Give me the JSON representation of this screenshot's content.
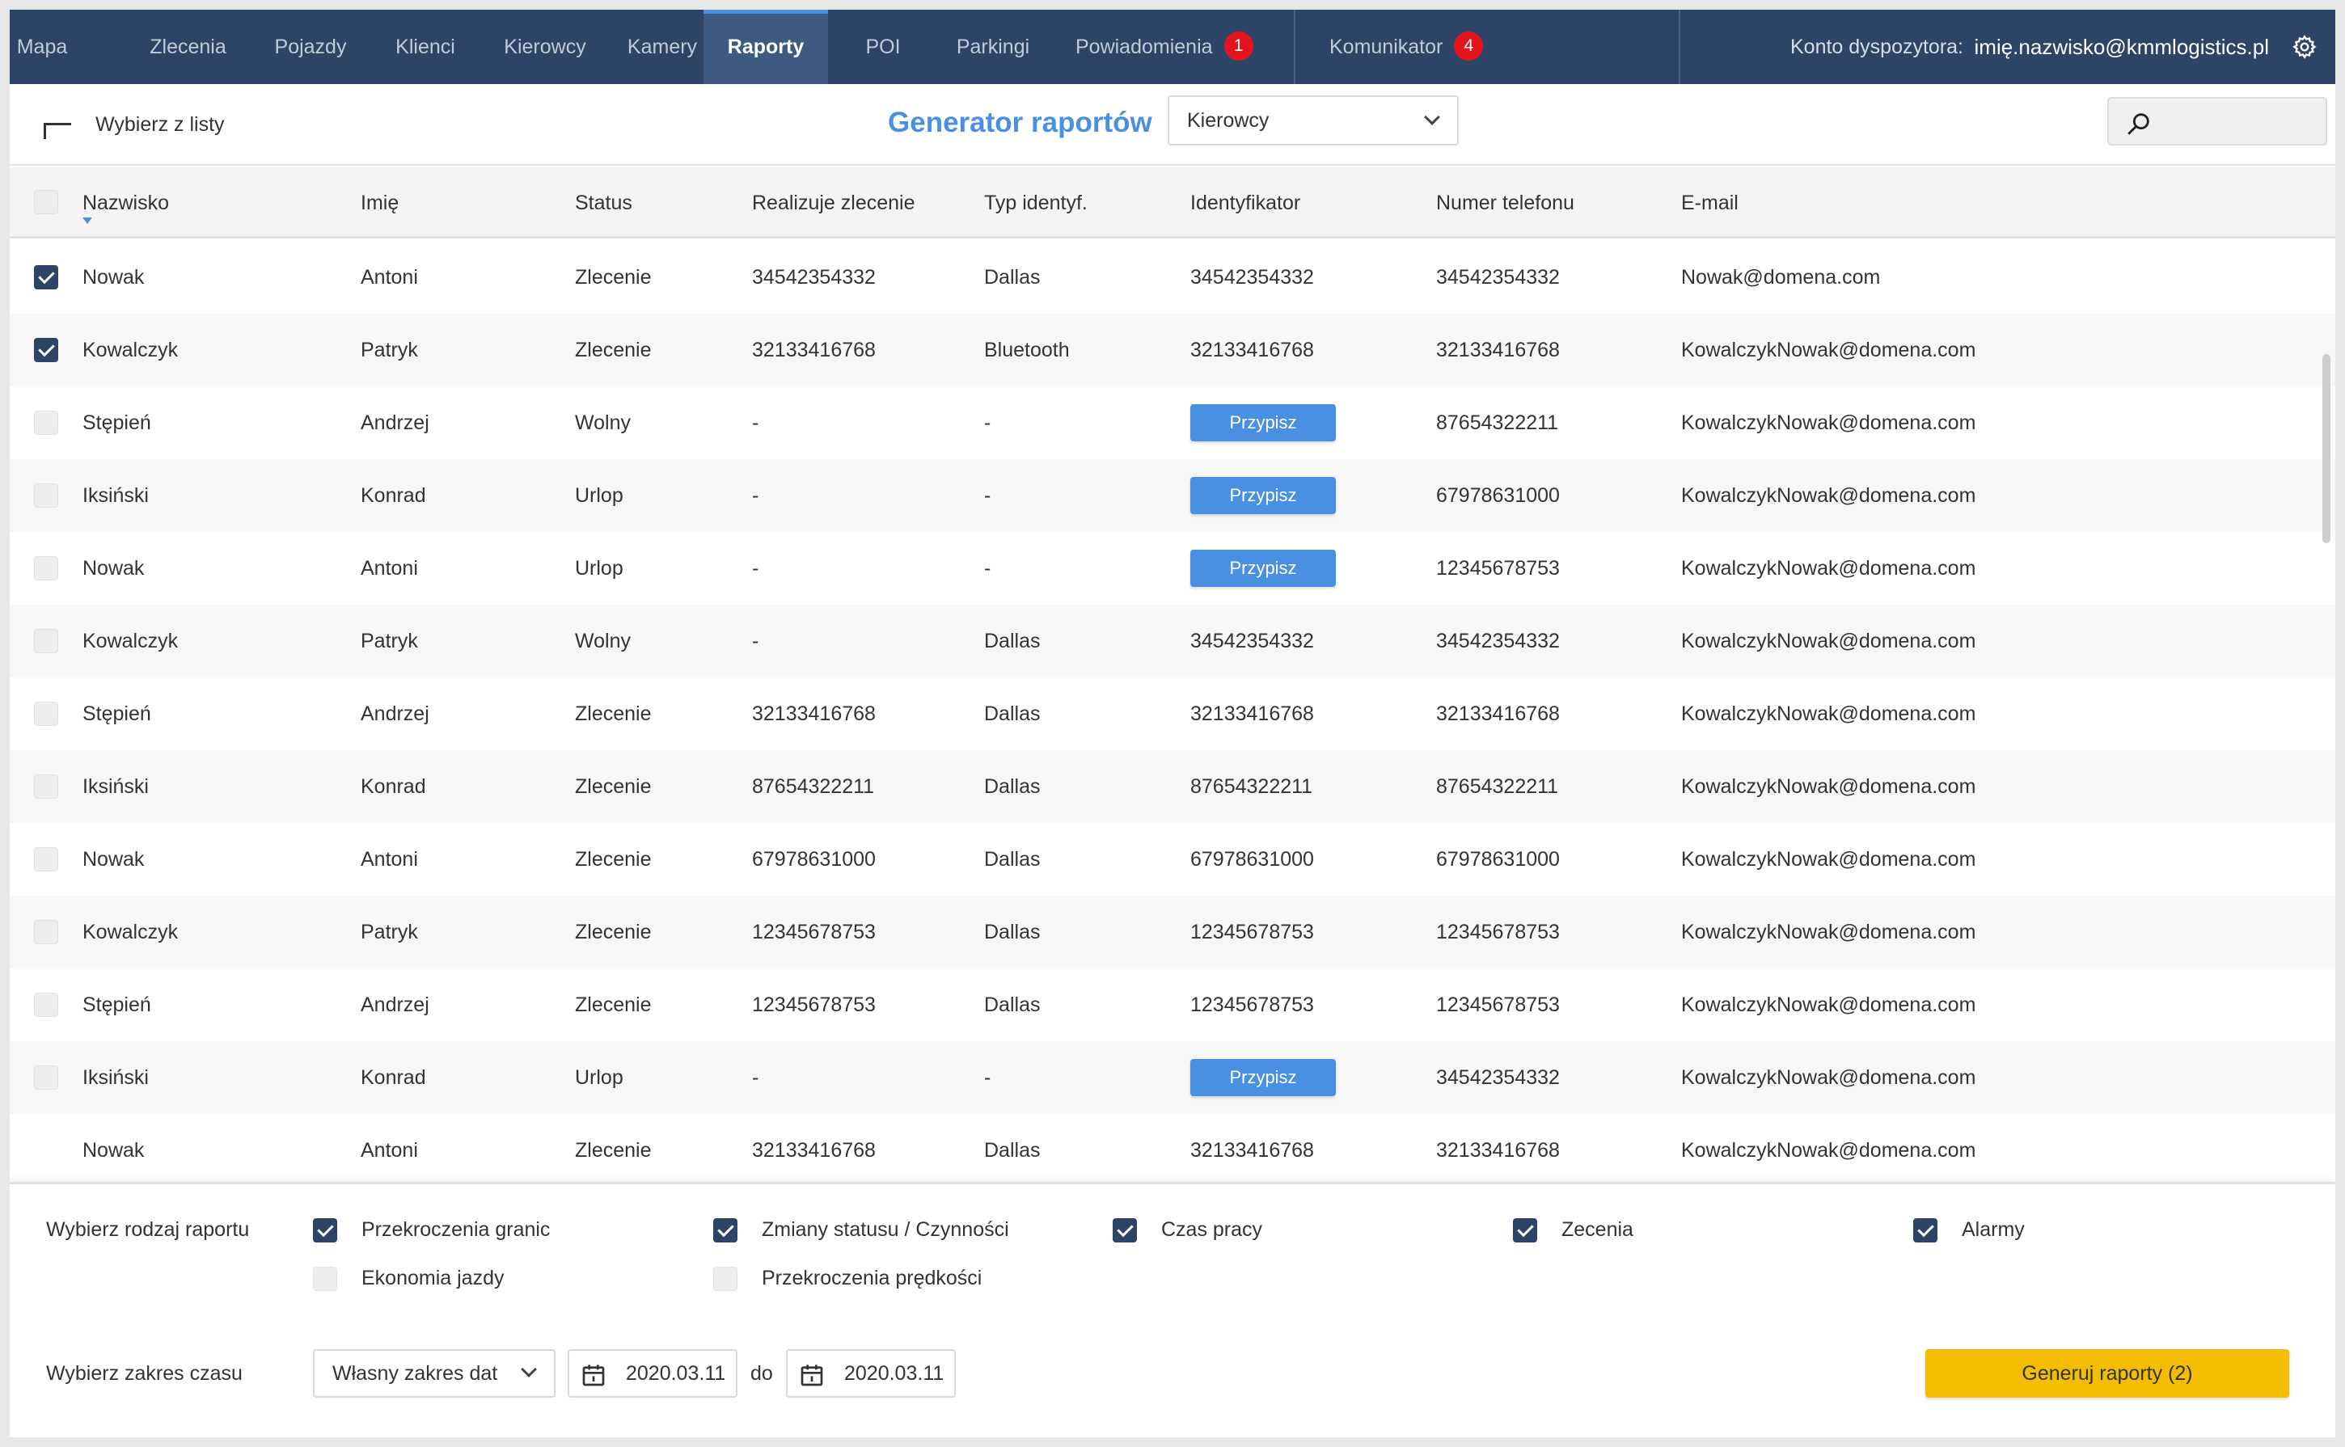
{
  "nav": {
    "tabs": [
      {
        "label": "Mapa",
        "badge": ""
      },
      {
        "label": "Zlecenia",
        "badge": ""
      },
      {
        "label": "Pojazdy",
        "badge": ""
      },
      {
        "label": "Klienci",
        "badge": ""
      },
      {
        "label": "Kierowcy",
        "badge": ""
      },
      {
        "label": "Kamery",
        "badge": ""
      },
      {
        "label": "Raporty",
        "badge": ""
      },
      {
        "label": "POI",
        "badge": ""
      },
      {
        "label": "Parkingi",
        "badge": ""
      },
      {
        "label": "Powiadomienia",
        "badge": "1"
      },
      {
        "label": "Komunikator",
        "badge": "4"
      }
    ],
    "active_tab": "Raporty",
    "account_label": "Konto dyspozytora:",
    "account_email": "imię.nazwisko@kmmlogistics.pl",
    "settings_icon": "gear-icon"
  },
  "toolbar": {
    "pick_label": "Wybierz z listy",
    "title": "Generator raportów",
    "entity_select": "Kierowcy",
    "search_placeholder": ""
  },
  "table": {
    "columns": [
      "Nazwisko",
      "Imię",
      "Status",
      "Realizuje zlecenie",
      "Typ identyf.",
      "Identyfikator",
      "Numer telefonu",
      "E-mail"
    ],
    "sorted_by": "Nazwisko",
    "assign_label": "Przypisz",
    "rows": [
      {
        "checked": true,
        "nazwisko": "Nowak",
        "imie": "Antoni",
        "status": "Zlecenie",
        "zlecenie": "34542354332",
        "typ": "Dallas",
        "ident": "34542354332",
        "tel": "34542354332",
        "email": "Nowak@domena.com"
      },
      {
        "checked": true,
        "nazwisko": "Kowalczyk",
        "imie": "Patryk",
        "status": "Zlecenie",
        "zlecenie": "32133416768",
        "typ": "Bluetooth",
        "ident": "32133416768",
        "tel": "32133416768",
        "email": "KowalczykNowak@domena.com"
      },
      {
        "checked": false,
        "nazwisko": "Stępień",
        "imie": "Andrzej",
        "status": "Wolny",
        "zlecenie": "-",
        "typ": "-",
        "ident": "",
        "tel": "87654322211",
        "email": "KowalczykNowak@domena.com"
      },
      {
        "checked": false,
        "nazwisko": "Iksiński",
        "imie": "Konrad",
        "status": "Urlop",
        "zlecenie": "-",
        "typ": "-",
        "ident": "",
        "tel": "67978631000",
        "email": "KowalczykNowak@domena.com"
      },
      {
        "checked": false,
        "nazwisko": "Nowak",
        "imie": "Antoni",
        "status": "Urlop",
        "zlecenie": "-",
        "typ": "-",
        "ident": "",
        "tel": "12345678753",
        "email": "KowalczykNowak@domena.com"
      },
      {
        "checked": false,
        "nazwisko": "Kowalczyk",
        "imie": "Patryk",
        "status": "Wolny",
        "zlecenie": "-",
        "typ": "Dallas",
        "ident": "34542354332",
        "tel": "34542354332",
        "email": "KowalczykNowak@domena.com"
      },
      {
        "checked": false,
        "nazwisko": "Stępień",
        "imie": "Andrzej",
        "status": "Zlecenie",
        "zlecenie": "32133416768",
        "typ": "Dallas",
        "ident": "32133416768",
        "tel": "32133416768",
        "email": "KowalczykNowak@domena.com"
      },
      {
        "checked": false,
        "nazwisko": "Iksiński",
        "imie": "Konrad",
        "status": "Zlecenie",
        "zlecenie": "87654322211",
        "typ": "Dallas",
        "ident": "87654322211",
        "tel": "87654322211",
        "email": "KowalczykNowak@domena.com"
      },
      {
        "checked": false,
        "nazwisko": "Nowak",
        "imie": "Antoni",
        "status": "Zlecenie",
        "zlecenie": "67978631000",
        "typ": "Dallas",
        "ident": "67978631000",
        "tel": "67978631000",
        "email": "KowalczykNowak@domena.com"
      },
      {
        "checked": false,
        "nazwisko": "Kowalczyk",
        "imie": "Patryk",
        "status": "Zlecenie",
        "zlecenie": "12345678753",
        "typ": "Dallas",
        "ident": "12345678753",
        "tel": "12345678753",
        "email": "KowalczykNowak@domena.com"
      },
      {
        "checked": false,
        "nazwisko": "Stępień",
        "imie": "Andrzej",
        "status": "Zlecenie",
        "zlecenie": "12345678753",
        "typ": "Dallas",
        "ident": "12345678753",
        "tel": "12345678753",
        "email": "KowalczykNowak@domena.com"
      },
      {
        "checked": false,
        "nazwisko": "Iksiński",
        "imie": "Konrad",
        "status": "Urlop",
        "zlecenie": "-",
        "typ": "-",
        "ident": "",
        "tel": "34542354332",
        "email": "KowalczykNowak@domena.com"
      },
      {
        "checked": false,
        "nazwisko": "Nowak",
        "imie": "Antoni",
        "status": "Zlecenie",
        "zlecenie": "32133416768",
        "typ": "Dallas",
        "ident": "32133416768",
        "tel": "32133416768",
        "email": "KowalczykNowak@domena.com"
      }
    ]
  },
  "report": {
    "type_label": "Wybierz rodzaj raportu",
    "types": [
      {
        "label": "Przekroczenia granic",
        "checked": true
      },
      {
        "label": "Zmiany statusu / Czynności",
        "checked": true
      },
      {
        "label": "Czas pracy",
        "checked": true
      },
      {
        "label": "Zecenia",
        "checked": true
      },
      {
        "label": "Alarmy",
        "checked": true
      },
      {
        "label": "Ekonomia jazdy",
        "checked": false
      },
      {
        "label": "Przekroczenia prędkości",
        "checked": false
      }
    ],
    "range_label": "Wybierz zakres czasu",
    "range_select": "Własny zakres dat",
    "date_from": "2020.03.11",
    "date_sep": "do",
    "date_to": "2020.03.11",
    "generate_label": "Generuj raporty (2)"
  },
  "colors": {
    "nav_bg": "#2d4466",
    "accent": "#4a90e2",
    "badge": "#e3141c",
    "generate": "#f5bd00"
  }
}
